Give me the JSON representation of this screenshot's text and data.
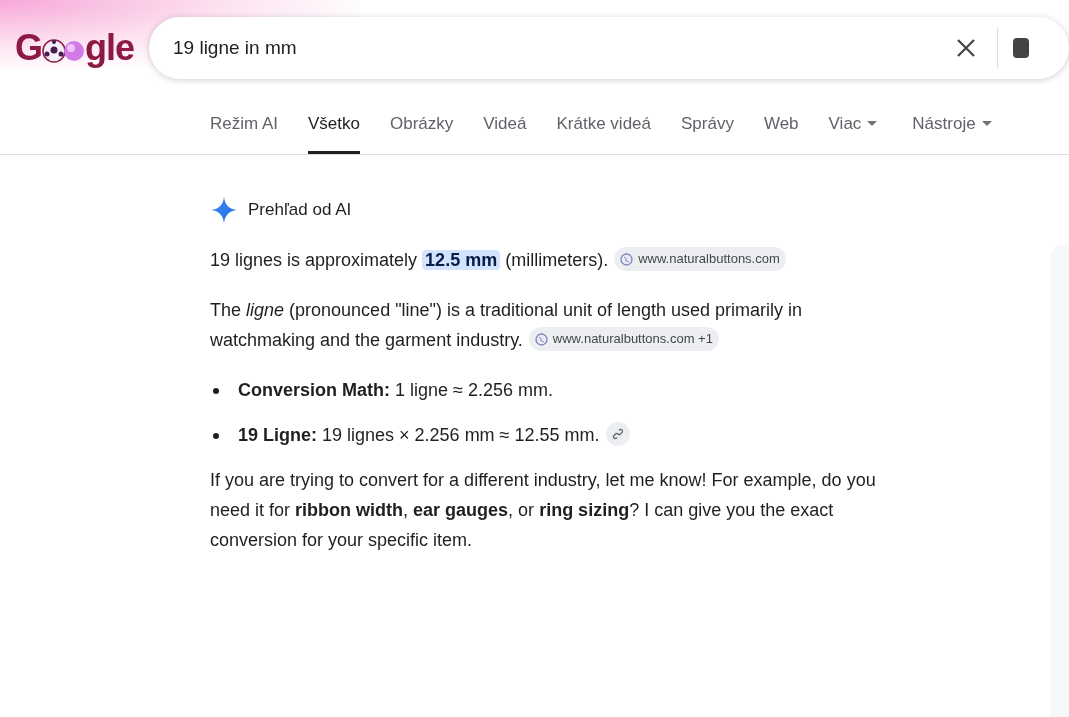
{
  "logo": {
    "prefix": "G",
    "suffix": "gle"
  },
  "search": {
    "value": "19 ligne in mm"
  },
  "tabs": [
    {
      "label": "Režim AI",
      "selected": false,
      "has_menu": false
    },
    {
      "label": "Všetko",
      "selected": true,
      "has_menu": false
    },
    {
      "label": "Obrázky",
      "selected": false,
      "has_menu": false
    },
    {
      "label": "Videá",
      "selected": false,
      "has_menu": false
    },
    {
      "label": "Krátke videá",
      "selected": false,
      "has_menu": false
    },
    {
      "label": "Správy",
      "selected": false,
      "has_menu": false
    },
    {
      "label": "Web",
      "selected": false,
      "has_menu": false
    },
    {
      "label": "Viac",
      "selected": false,
      "has_menu": true
    },
    {
      "label": "Nástroje",
      "selected": false,
      "has_menu": true
    }
  ],
  "ai_overview": {
    "title": "Prehľad od AI",
    "blocks": [
      {
        "kind": "paragraph",
        "segments": [
          {
            "text": "19 lignes is approximately ",
            "highlight": false
          },
          {
            "text": "12.5 mm",
            "highlight": true
          },
          {
            "text": " (millimeters).",
            "highlight": false
          }
        ],
        "source": "www.naturalbuttons.com"
      },
      {
        "kind": "paragraph",
        "segments": [
          {
            "text": "The *ligne* (pronounced \"line\") is a traditional unit of length used primarily in watchmaking and the garment industry.",
            "highlight": false
          }
        ],
        "source": "www.naturalbuttons.com +1"
      },
      {
        "kind": "bullet",
        "segments": [
          {
            "text": "**Conversion Math:** 1 ligne ≈ 2.256 mm.",
            "highlight": false
          }
        ]
      },
      {
        "kind": "bullet",
        "segments": [
          {
            "text": "**19 Ligne:** 19 lignes × 2.256 mm ≈ 12.55 mm.",
            "highlight": false
          }
        ],
        "link": true
      },
      {
        "kind": "paragraph",
        "segments": [
          {
            "text": "If you are trying to convert for a different industry, let me know! For example, do you need it for **ribbon width**, **ear gauges**, or **ring sizing**? I can give you the exact conversion for your specific item.",
            "highlight": false
          }
        ]
      }
    ]
  }
}
